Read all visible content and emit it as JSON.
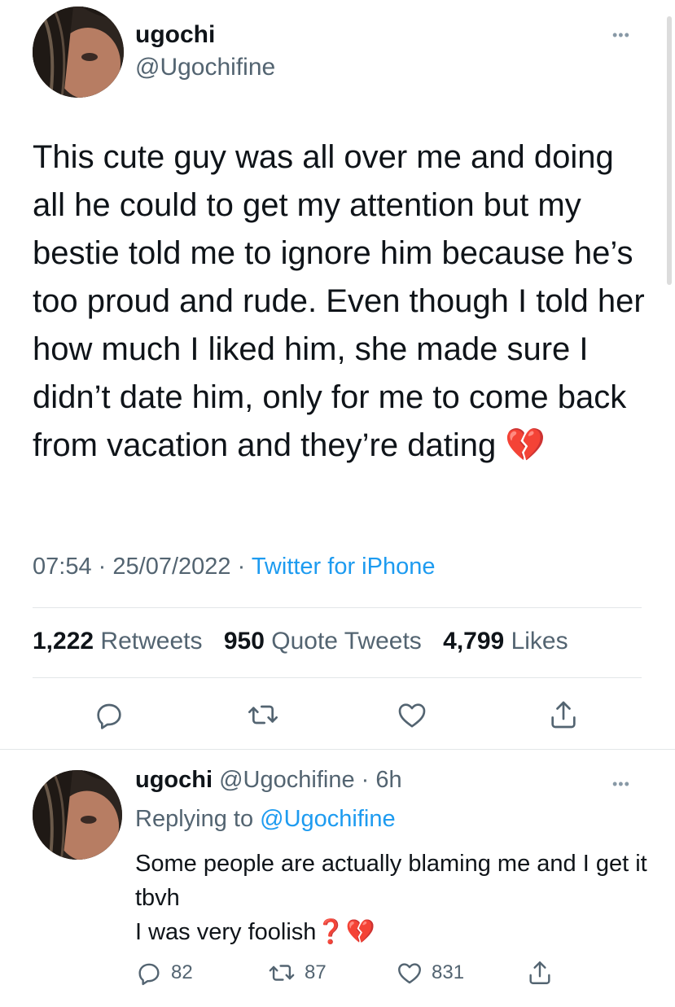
{
  "tweet": {
    "author": {
      "name": "ugochi",
      "handle": "@Ugochifine"
    },
    "text": "This cute guy was all over me and doing all he could to get my attention but my bestie told me to ignore him because he’s too proud and rude. Even though I told her how much I liked him, she made sure I didn’t date him, only for me to come back from vacation and they’re dating 💔",
    "time": "07:54",
    "date": "25/07/2022",
    "source": "Twitter for iPhone",
    "separator": "·",
    "stats": {
      "retweets_count": "1,222",
      "retweets_label": "Retweets",
      "quotes_count": "950",
      "quotes_label": "Quote Tweets",
      "likes_count": "4,799",
      "likes_label": "Likes"
    },
    "actions": [
      "reply-icon",
      "retweet-icon",
      "like-icon",
      "share-icon"
    ]
  },
  "reply": {
    "author": {
      "name": "ugochi",
      "handle": "@Ugochifine",
      "age": "· 6h"
    },
    "replying_prefix": "Replying to",
    "replying_handle": "@Ugochifine",
    "text": "Some people are actually blaming me and I get it tbvh\nI was very foolish❓💔",
    "counts": {
      "replies": "82",
      "retweets": "87",
      "likes": "831"
    }
  },
  "colors": {
    "accent": "#1d9bf0",
    "muted": "#536471",
    "icon": "#536471",
    "text": "#0f1419"
  },
  "more_icon": "•••"
}
